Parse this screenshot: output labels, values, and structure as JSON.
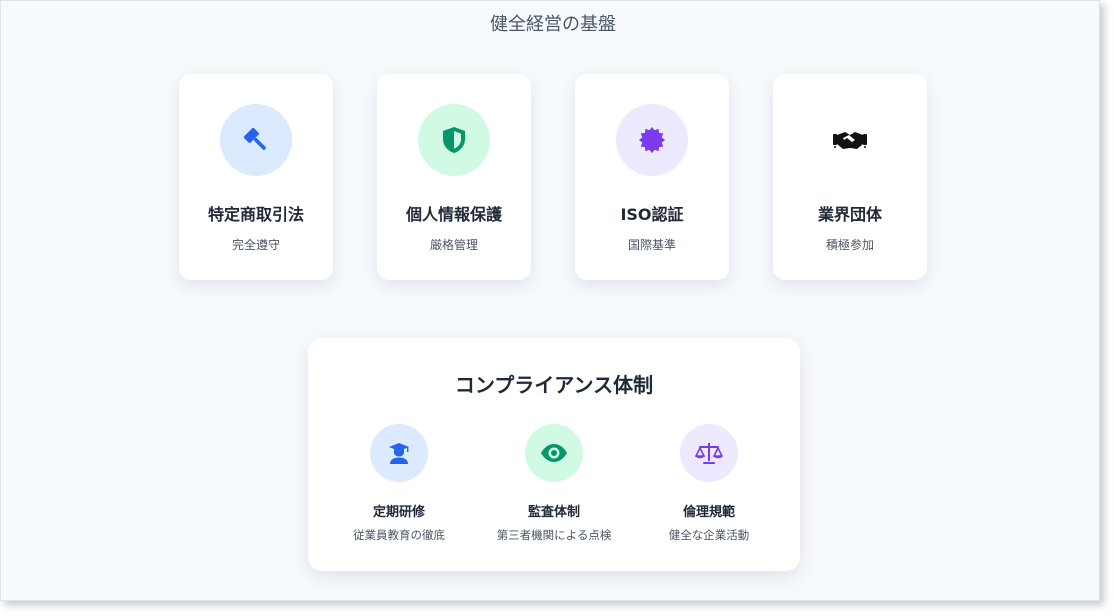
{
  "page": {
    "title": "健全経営の基盤"
  },
  "cards": [
    {
      "title": "特定商取引法",
      "subtitle": "完全遵守",
      "icon": "gavel-icon",
      "icon_color": "#2563eb",
      "bg_color": "#dbeafe"
    },
    {
      "title": "個人情報保護",
      "subtitle": "厳格管理",
      "icon": "shield-icon",
      "icon_color": "#059669",
      "bg_color": "#d1fae5"
    },
    {
      "title": "ISO認証",
      "subtitle": "国際基準",
      "icon": "certificate-badge-icon",
      "icon_color": "#7c3aed",
      "bg_color": "#ede9fe"
    },
    {
      "title": "業界団体",
      "subtitle": "積極参加",
      "icon": "handshake-icon",
      "icon_color": "#111111",
      "bg_color": "#ffffff"
    }
  ],
  "compliance": {
    "title": "コンプライアンス体制",
    "items": [
      {
        "title": "定期研修",
        "subtitle": "従業員教育の徹底",
        "icon": "graduate-icon",
        "icon_color": "#2563eb",
        "bg_color": "#dbeafe"
      },
      {
        "title": "監査体制",
        "subtitle": "第三者機関による点検",
        "icon": "eye-icon",
        "icon_color": "#059669",
        "bg_color": "#d1fae5"
      },
      {
        "title": "倫理規範",
        "subtitle": "健全な企業活動",
        "icon": "balance-scale-icon",
        "icon_color": "#7c3aed",
        "bg_color": "#ede9fe"
      }
    ]
  }
}
